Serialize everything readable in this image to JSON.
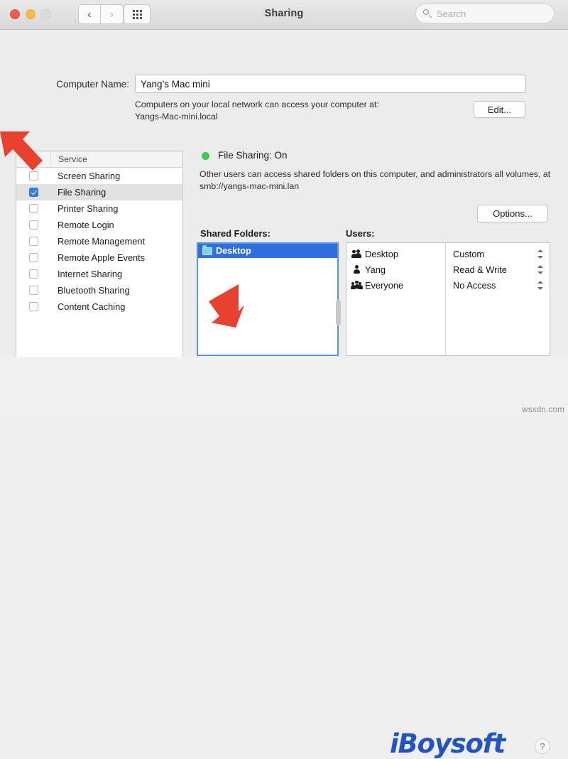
{
  "window": {
    "title": "Sharing",
    "traffic_lights": [
      "close",
      "minimize",
      "zoom"
    ],
    "nav": {
      "back": "‹",
      "forward": "›",
      "show_all": "grid-icon"
    },
    "search": {
      "placeholder": "Search",
      "value": ""
    }
  },
  "computer_name": {
    "label": "Computer Name:",
    "value": "Yang’s Mac mini",
    "description_line1": "Computers on your local network can access your computer at:",
    "description_line2": "Yangs-Mac-mini.local",
    "edit_label": "Edit..."
  },
  "services": {
    "columns": {
      "on": "On",
      "service": "Service"
    },
    "items": [
      {
        "name": "Screen Sharing",
        "checked": false,
        "selected": false
      },
      {
        "name": "File Sharing",
        "checked": true,
        "selected": true
      },
      {
        "name": "Printer Sharing",
        "checked": false,
        "selected": false
      },
      {
        "name": "Remote Login",
        "checked": false,
        "selected": false
      },
      {
        "name": "Remote Management",
        "checked": false,
        "selected": false
      },
      {
        "name": "Remote Apple Events",
        "checked": false,
        "selected": false
      },
      {
        "name": "Internet Sharing",
        "checked": false,
        "selected": false
      },
      {
        "name": "Bluetooth Sharing",
        "checked": false,
        "selected": false
      },
      {
        "name": "Content Caching",
        "checked": false,
        "selected": false
      }
    ]
  },
  "detail": {
    "status_title": "File Sharing: On",
    "status_color": "#3ecb4a",
    "description": "Other users can access shared folders on this computer, and administrators all volumes, at smb://yangs-mac-mini.lan",
    "options_label": "Options...",
    "shared_folders_label": "Shared Folders:",
    "users_label": "Users:",
    "shared_folders": [
      {
        "name": "Desktop",
        "icon": "folder-icon",
        "selected": true
      }
    ],
    "users": [
      {
        "name": "Desktop",
        "icon": "two-person-icon",
        "permission": "Custom"
      },
      {
        "name": "Yang",
        "icon": "person-icon",
        "permission": "Read & Write"
      },
      {
        "name": "Everyone",
        "icon": "three-person-icon",
        "permission": "No Access"
      }
    ],
    "folder_buttons": {
      "add": "+",
      "remove": "−",
      "remove_enabled": true
    },
    "user_buttons": {
      "add": "+",
      "remove": "−",
      "remove_enabled": false
    }
  },
  "branding": {
    "logo": "iBoysoft",
    "logo_color": "#2255c4",
    "help_label": "?",
    "watermark": "wsxdn.com"
  },
  "annotations": [
    {
      "name": "arrow-to-file-sharing-checkbox",
      "color": "#e8412e"
    },
    {
      "name": "arrow-to-add-folder-button",
      "color": "#e8412e"
    }
  ]
}
